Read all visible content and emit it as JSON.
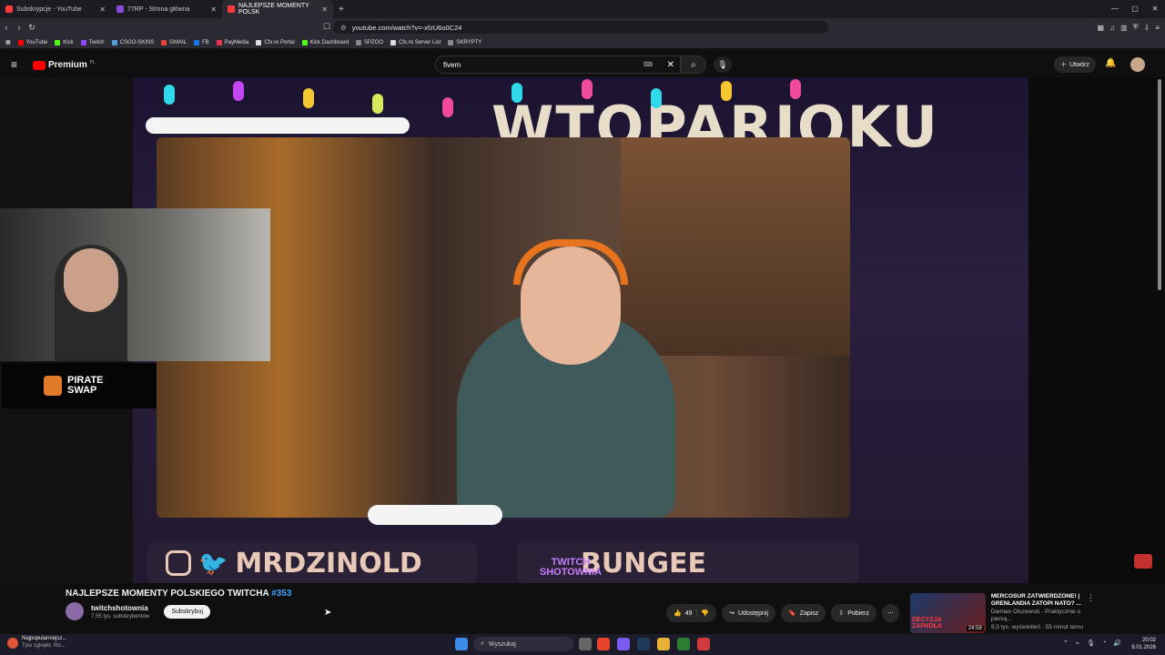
{
  "browser": {
    "tabs": [
      {
        "label": "Subskrypcje - YouTube",
        "color": "#ff3b3b"
      },
      {
        "label": "77RP - Strona główna",
        "color": "#8a4bd8"
      },
      {
        "label": "NAJLEPSZE MOMENTY POLSK",
        "color": "#ff3b3b"
      }
    ],
    "url": "youtube.com/watch?v=-xfzU6o0C24",
    "bookmarks": [
      "YouTube",
      "Kick",
      "Twitch",
      "CSGO-SKINS",
      "GMAIL",
      "FB",
      "PayMedia",
      "Cfx.re Portal",
      "Kick Dashboard",
      "SPZOO",
      "Cfx.re Server List",
      "SKRYPTY"
    ]
  },
  "youtube": {
    "logo": "Premium",
    "logo_region": "PL",
    "search_value": "fivem",
    "create_label": "Utwórz"
  },
  "video_overlay": {
    "banner_text": "WTOPARIOKU",
    "social_handle": "MRDZINOLD",
    "right_panel_text": "BUNGEE",
    "watermark": "TWITCH SHOTOWNIA",
    "sponsor": "PIRATE SWAP"
  },
  "video": {
    "title": "NAJLEPSZE MOMENTY POLSKIEGO TWITCHA",
    "hashtag": "#353",
    "channel": "twitchshotownia",
    "subscribers": "7,55 tys. subskrybentów",
    "subscribe_label": "Subskrybuj",
    "likes": "49",
    "share_label": "Udostępnij",
    "save_label": "Zapisz",
    "download_label": "Pobierz"
  },
  "recommendation": {
    "title_line1": "MERCOSUR ZATWIERDZONE! |",
    "title_line2": "GRENLANDIA ZATOPI NATO? ...",
    "channel": "Damian Olszewski - Praktycznie o pienią...",
    "meta": "9,5 tys. wyświetleń · 55 minut temu",
    "duration": "24:58",
    "thumb_text": "DECYZJA ZAPADŁA"
  },
  "taskbar": {
    "weather_line1": "Najpopularniejsz...",
    "weather_line2": "Tylu zginęło. Ro...",
    "search_label": "Wyszukaj",
    "time": "20:02",
    "date": "9.01.2026"
  }
}
